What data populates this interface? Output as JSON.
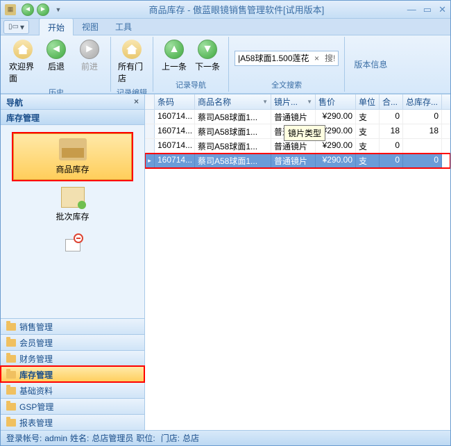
{
  "window": {
    "title": "商品库存 - 傲蓝眼镜销售管理软件[试用版本]"
  },
  "tabs": {
    "start": "开始",
    "view": "视图",
    "tools": "工具"
  },
  "ribbon": {
    "welcome": "欢迎界面",
    "back": "后退",
    "forward": "前进",
    "history_group": "历史",
    "allstore": "所有门店",
    "edit_group": "记录编辑",
    "prev": "上一条",
    "next": "下一条",
    "nav_group": "记录导航",
    "search_value": "|A58球面1.500莲花",
    "search_btn": "搜!",
    "search_group": "全文搜索",
    "version": "版本信息"
  },
  "sidebar": {
    "title": "导航",
    "subtitle": "库存管理",
    "items": [
      {
        "label": "商品库存",
        "sel": true
      },
      {
        "label": "批次库存",
        "sel": false
      },
      {
        "label": "",
        "sel": false
      }
    ],
    "cats": [
      "销售管理",
      "会员管理",
      "财务管理",
      "库存管理",
      "基础资料",
      "GSP管理",
      "报表管理"
    ],
    "active_cat": 3
  },
  "grid": {
    "cols": [
      "条码",
      "商品名称",
      "镜片...",
      "售价",
      "单位",
      "合...",
      "总库存..."
    ],
    "tooltip": "镜片类型",
    "rows": [
      {
        "code": "160714...",
        "name": "蔡司A58球面1...",
        "lens": "普通镜片",
        "price": "¥290.00",
        "unit": "支",
        "sum": "0",
        "stock": "0"
      },
      {
        "code": "160714...",
        "name": "蔡司A58球面1...",
        "lens": "普通镜片",
        "price": "¥290.00",
        "unit": "支",
        "sum": "18",
        "stock": "18"
      },
      {
        "code": "160714...",
        "name": "蔡司A58球面1...",
        "lens": "普通镜片",
        "price": "¥290.00",
        "unit": "支",
        "sum": "0",
        "stock": ""
      },
      {
        "code": "160714...",
        "name": "蔡司A58球面1...",
        "lens": "普通镜片",
        "price": "¥290.00",
        "unit": "支",
        "sum": "0",
        "stock": "0"
      }
    ],
    "selected": 3
  },
  "status": {
    "acct_l": "登录帐号:",
    "acct_v": "admin",
    "name_l": "姓名:",
    "name_v": "总店管理员",
    "pos_l": "职位:",
    "pos_v": "",
    "store_l": "门店:",
    "store_v": "总店"
  }
}
